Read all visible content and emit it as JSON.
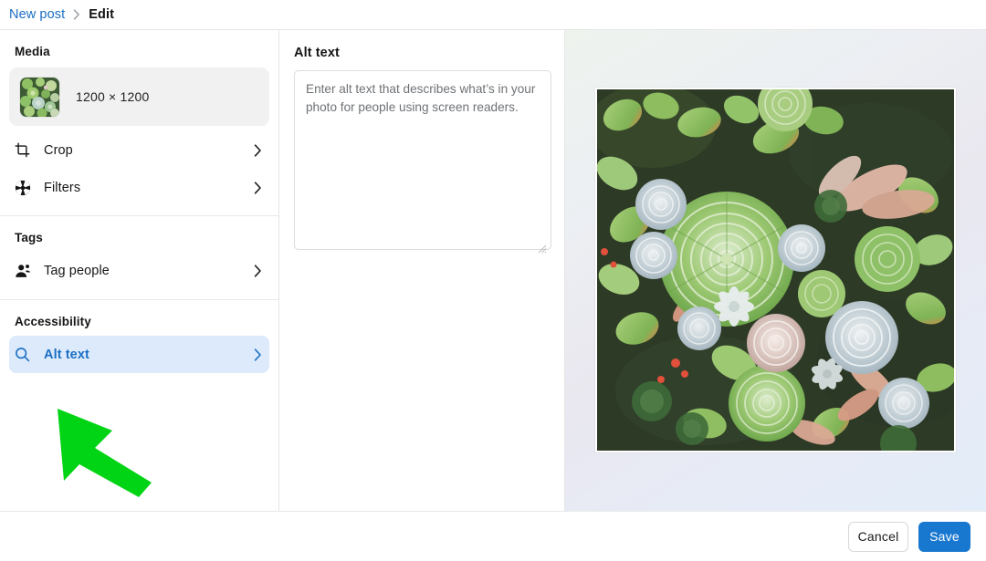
{
  "breadcrumb": {
    "parent": "New post",
    "separator": "›",
    "current": "Edit"
  },
  "sidebar": {
    "sections": [
      {
        "title": "Media",
        "media_card": {
          "thumbnail_icon": "image-thumbnail",
          "dimensions": "1200 × 1200"
        },
        "items": [
          {
            "label": "Crop",
            "icon": "crop-icon",
            "chevron": "›",
            "active": false
          },
          {
            "label": "Filters",
            "icon": "aperture-icon",
            "chevron": "›",
            "active": false
          }
        ]
      },
      {
        "title": "Tags",
        "items": [
          {
            "label": "Tag people",
            "icon": "people-icon",
            "chevron": "›",
            "active": false
          }
        ]
      },
      {
        "title": "Accessibility",
        "items": [
          {
            "label": "Alt text",
            "icon": "search-icon",
            "chevron": "›",
            "active": true
          }
        ]
      }
    ]
  },
  "main": {
    "title": "Alt text",
    "alt_textarea": {
      "value": "",
      "placeholder": "Enter alt text that describes what’s in your photo for people using screen readers."
    },
    "resize_handle_icon": "resize-handle-icon"
  },
  "preview": {
    "image_alt": "Dense garden of green and pale blue succulent rosettes with red-tipped jade leaves"
  },
  "footer": {
    "cancel_label": "Cancel",
    "save_label": "Save"
  },
  "annotation": {
    "arrow_icon": "green-pointer-arrow",
    "color": "#00d414",
    "points_to": "Alt text"
  },
  "colors": {
    "link_blue": "#1b6fc4",
    "accent_blue": "#1877cf",
    "active_row_bg": "#dceafb",
    "panel_border": "#e6e6e6",
    "media_card_bg": "#f1f1f1",
    "text_dark": "#161616",
    "placeholder_grey": "#6e7276",
    "annotation_green": "#00d414"
  }
}
